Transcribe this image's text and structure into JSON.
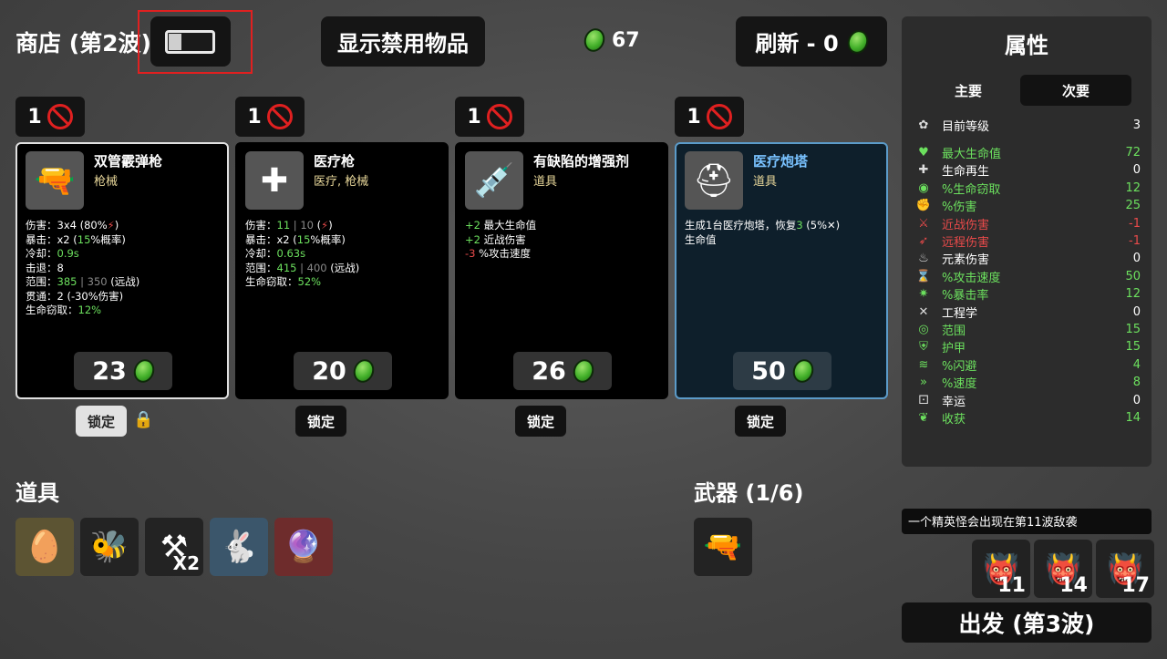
{
  "shop_title": "商店 (第2波)",
  "show_banned_label": "显示禁用物品",
  "materials": "67",
  "refresh_label": "刷新 - 0",
  "lock_label": "锁定",
  "cards": [
    {
      "ban_count": "1",
      "name": "双管霰弹枪",
      "type": "枪械",
      "icon": "shotgun-icon",
      "price": "23",
      "locked": true,
      "stats": [
        [
          [
            "伤害：3x4 (80%",
            ""
          ],
          [
            "⚡",
            "r"
          ],
          [
            ")",
            ""
          ]
        ],
        [
          [
            "暴击：x2 (",
            ""
          ],
          [
            "15",
            "g"
          ],
          [
            "%概率)",
            ""
          ]
        ],
        [
          [
            "冷却：",
            ""
          ],
          [
            "0.9s",
            "g"
          ]
        ],
        [
          [
            "击退：8",
            ""
          ]
        ],
        [
          [
            "范围：",
            ""
          ],
          [
            "385",
            "g"
          ],
          [
            " | 350",
            "dim"
          ],
          [
            " (远战)",
            ""
          ]
        ],
        [
          [
            "贯通：2 (-30%伤害)",
            ""
          ]
        ],
        [
          [
            "生命窃取：",
            ""
          ],
          [
            "12%",
            "g"
          ]
        ]
      ]
    },
    {
      "ban_count": "1",
      "name": "医疗枪",
      "type": "医疗, 枪械",
      "icon": "medical-gun-icon",
      "price": "20",
      "locked": false,
      "stats": [
        [
          [
            "伤害：",
            ""
          ],
          [
            "11",
            "g"
          ],
          [
            " | 10",
            "dim"
          ],
          [
            " (",
            ""
          ],
          [
            "⚡",
            "r"
          ],
          [
            ")",
            ""
          ]
        ],
        [
          [
            "暴击：x2 (",
            ""
          ],
          [
            "15",
            "g"
          ],
          [
            "%概率)",
            ""
          ]
        ],
        [
          [
            "冷却：",
            ""
          ],
          [
            "0.63s",
            "g"
          ]
        ],
        [
          [
            "范围：",
            ""
          ],
          [
            "415",
            "g"
          ],
          [
            " | 400",
            "dim"
          ],
          [
            " (远战)",
            ""
          ]
        ],
        [
          [
            "生命窃取：",
            ""
          ],
          [
            "52%",
            "g"
          ]
        ]
      ]
    },
    {
      "ban_count": "1",
      "name": "有缺陷的增强剂",
      "type": "道具",
      "icon": "syringe-icon",
      "price": "26",
      "locked": false,
      "stats": [
        [
          [
            "+2",
            "g"
          ],
          [
            " 最大生命值",
            ""
          ]
        ],
        [
          [
            "+2",
            "g"
          ],
          [
            " 近战伤害",
            ""
          ]
        ],
        [
          [
            "-3",
            "r"
          ],
          [
            " %攻击速度",
            ""
          ]
        ]
      ]
    },
    {
      "ban_count": "1",
      "name": "医疗炮塔",
      "type": "道具",
      "icon": "medical-turret-icon",
      "price": "50",
      "locked": false,
      "stats": [
        [
          [
            "生成1台医疗炮塔，恢复",
            ""
          ],
          [
            "3",
            "g"
          ],
          [
            " (5%✕)",
            ""
          ]
        ],
        [
          [
            "生命值",
            ""
          ]
        ]
      ]
    }
  ],
  "items_header": "道具",
  "items": [
    {
      "icon": "egg-icon",
      "qty": "",
      "bg": "#5c5433"
    },
    {
      "icon": "bee-icon",
      "qty": "",
      "bg": "#232323"
    },
    {
      "icon": "scythe-icon",
      "qty": "X2",
      "bg": "#232323"
    },
    {
      "icon": "rabbit-icon",
      "qty": "",
      "bg": "#3b566b"
    },
    {
      "icon": "crystal-ball-icon",
      "qty": "",
      "bg": "#6e2c2c"
    }
  ],
  "weapons_header": "武器 (1/6)",
  "weapons": [
    {
      "icon": "shotgun-icon"
    }
  ],
  "stats_panel": {
    "title": "属性",
    "tab_primary": "主要",
    "tab_secondary": "次要",
    "rows": [
      {
        "icon": "level-icon",
        "label": "目前等级",
        "value": "3",
        "color": "#ffffff",
        "glyph": "✿"
      },
      {
        "icon": "heart-icon",
        "label": "最大生命值",
        "value": "72",
        "color": "#6ce05e",
        "glyph": "♥"
      },
      {
        "icon": "regen-icon",
        "label": "生命再生",
        "value": "0",
        "color": "#ffffff",
        "glyph": "✚"
      },
      {
        "icon": "lifesteal-icon",
        "label": "%生命窃取",
        "value": "12",
        "color": "#6ce05e",
        "glyph": "◉"
      },
      {
        "icon": "damage-icon",
        "label": "%伤害",
        "value": "25",
        "color": "#6ce05e",
        "glyph": "✊"
      },
      {
        "icon": "melee-icon",
        "label": "近战伤害",
        "value": "-1",
        "color": "#e84a4a",
        "glyph": "⚔"
      },
      {
        "icon": "ranged-icon",
        "label": "远程伤害",
        "value": "-1",
        "color": "#e84a4a",
        "glyph": "➶"
      },
      {
        "icon": "elemental-icon",
        "label": "元素伤害",
        "value": "0",
        "color": "#ffffff",
        "glyph": "♨"
      },
      {
        "icon": "attack-speed-icon",
        "label": "%攻击速度",
        "value": "50",
        "color": "#6ce05e",
        "glyph": "⌛"
      },
      {
        "icon": "crit-icon",
        "label": "%暴击率",
        "value": "12",
        "color": "#6ce05e",
        "glyph": "✷"
      },
      {
        "icon": "engineering-icon",
        "label": "工程学",
        "value": "0",
        "color": "#ffffff",
        "glyph": "✕"
      },
      {
        "icon": "range-icon",
        "label": "范围",
        "value": "15",
        "color": "#6ce05e",
        "glyph": "◎"
      },
      {
        "icon": "armor-icon",
        "label": "护甲",
        "value": "15",
        "color": "#6ce05e",
        "glyph": "⛨"
      },
      {
        "icon": "dodge-icon",
        "label": "%闪避",
        "value": "4",
        "color": "#6ce05e",
        "glyph": "≋"
      },
      {
        "icon": "speed-icon",
        "label": "%速度",
        "value": "8",
        "color": "#6ce05e",
        "glyph": "»"
      },
      {
        "icon": "luck-icon",
        "label": "幸运",
        "value": "0",
        "color": "#ffffff",
        "glyph": "⚀"
      },
      {
        "icon": "harvest-icon",
        "label": "收获",
        "value": "14",
        "color": "#6ce05e",
        "glyph": "❦"
      }
    ]
  },
  "elite_notice": "一个精英怪会出现在第11波敌袭",
  "enemy_waves": [
    {
      "wave": "11"
    },
    {
      "wave": "14"
    },
    {
      "wave": "17"
    }
  ],
  "go_button": "出发 (第3波)",
  "colors": {
    "green": "#6ce05e",
    "red": "#e84a4a",
    "coin": "#43b02a",
    "highlight": "#e02020",
    "blue_card": "#5b9bc9"
  }
}
